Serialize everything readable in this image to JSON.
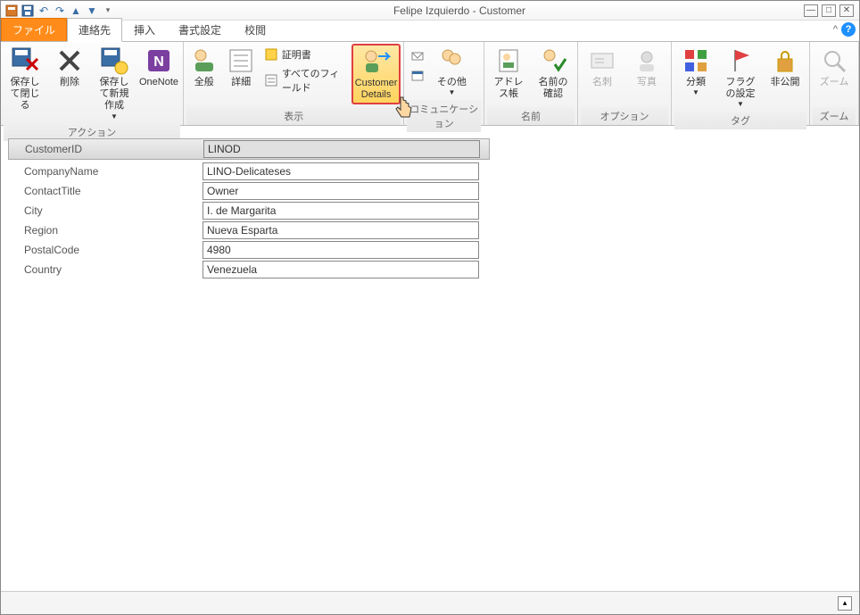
{
  "window": {
    "title": "Felipe Izquierdo - Customer"
  },
  "qat": {
    "undo": "↶",
    "redo": "↷",
    "up": "↑",
    "down": "▼"
  },
  "tabs": {
    "file": "ファイル",
    "contact": "連絡先",
    "insert": "挿入",
    "format": "書式設定",
    "review": "校閲"
  },
  "ribbon": {
    "groups": {
      "action": {
        "label": "アクション",
        "save_close": "保存して閉じる",
        "delete": "削除",
        "save_new": "保存して新規作成",
        "onenote": "OneNote"
      },
      "display": {
        "label": "表示",
        "general": "全般",
        "details": "詳細",
        "certificate": "証明書",
        "all_fields": "すべてのフィールド",
        "customer_details": "Customer Details"
      },
      "communication": {
        "label": "コミュニケーション",
        "other": "その他"
      },
      "name": {
        "label": "名前",
        "address_book": "アドレス帳",
        "check_names": "名前の確認"
      },
      "option": {
        "label": "オプション",
        "business_card": "名刺",
        "photo": "写真"
      },
      "tag": {
        "label": "タグ",
        "categorize": "分類",
        "flag_settings": "フラグの設定",
        "private": "非公開"
      },
      "zoom": {
        "label": "ズーム",
        "zoom": "ズーム"
      }
    }
  },
  "form": {
    "labels": {
      "customer_id": "CustomerID",
      "company_name": "CompanyName",
      "contact_title": "ContactTitle",
      "city": "City",
      "region": "Region",
      "postal_code": "PostalCode",
      "country": "Country"
    },
    "values": {
      "customer_id": "LINOD",
      "company_name": "LINO-Delicateses",
      "contact_title": "Owner",
      "city": "I. de Margarita",
      "region": "Nueva Esparta",
      "postal_code": "4980",
      "country": "Venezuela"
    }
  }
}
